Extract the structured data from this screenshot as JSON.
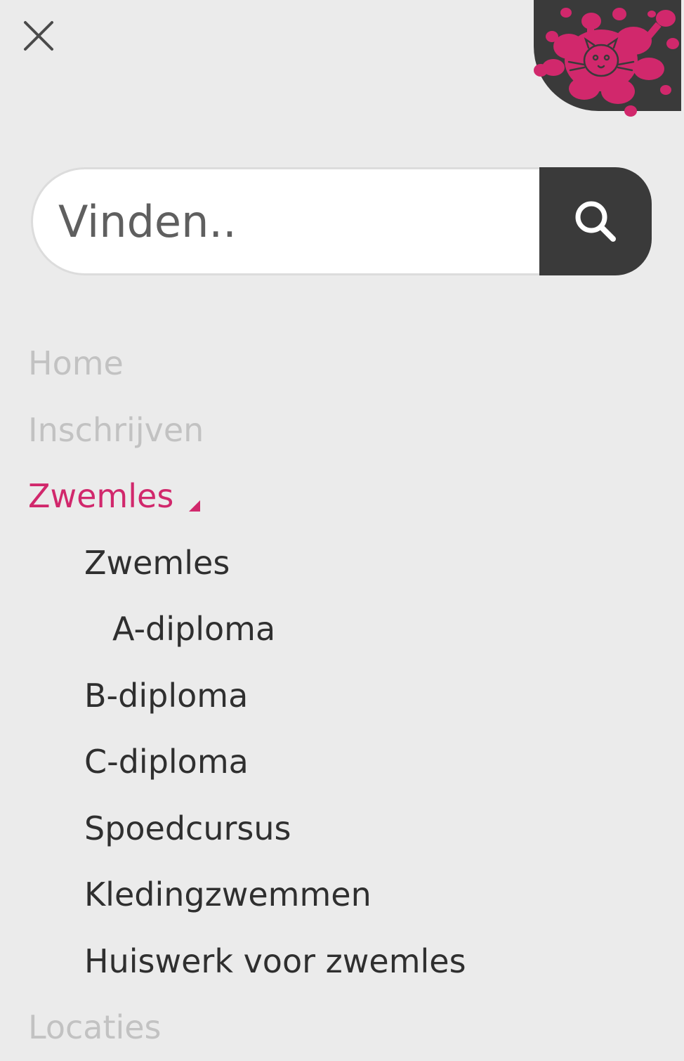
{
  "header": {
    "close_icon": "close-icon",
    "logo_icon": "paint-splash-cat-logo",
    "logo_bg_color": "#3a3a3a",
    "logo_splash_color": "#d1286c"
  },
  "search": {
    "placeholder": "Vinden..",
    "button_icon": "search-icon"
  },
  "nav": {
    "accent_color": "#d1286c",
    "items": [
      {
        "label": "Home"
      },
      {
        "label": "Inschrijven"
      },
      {
        "label": "Zwemles",
        "expanded_icon": "caret-icon"
      },
      {
        "label": "Zwemles"
      },
      {
        "label": "A-diploma"
      },
      {
        "label": "B-diploma"
      },
      {
        "label": "C-diploma"
      },
      {
        "label": "Spoedcursus"
      },
      {
        "label": "Kledingzwemmen"
      },
      {
        "label": "Huiswerk voor zwemles"
      },
      {
        "label": "Locaties"
      }
    ]
  }
}
